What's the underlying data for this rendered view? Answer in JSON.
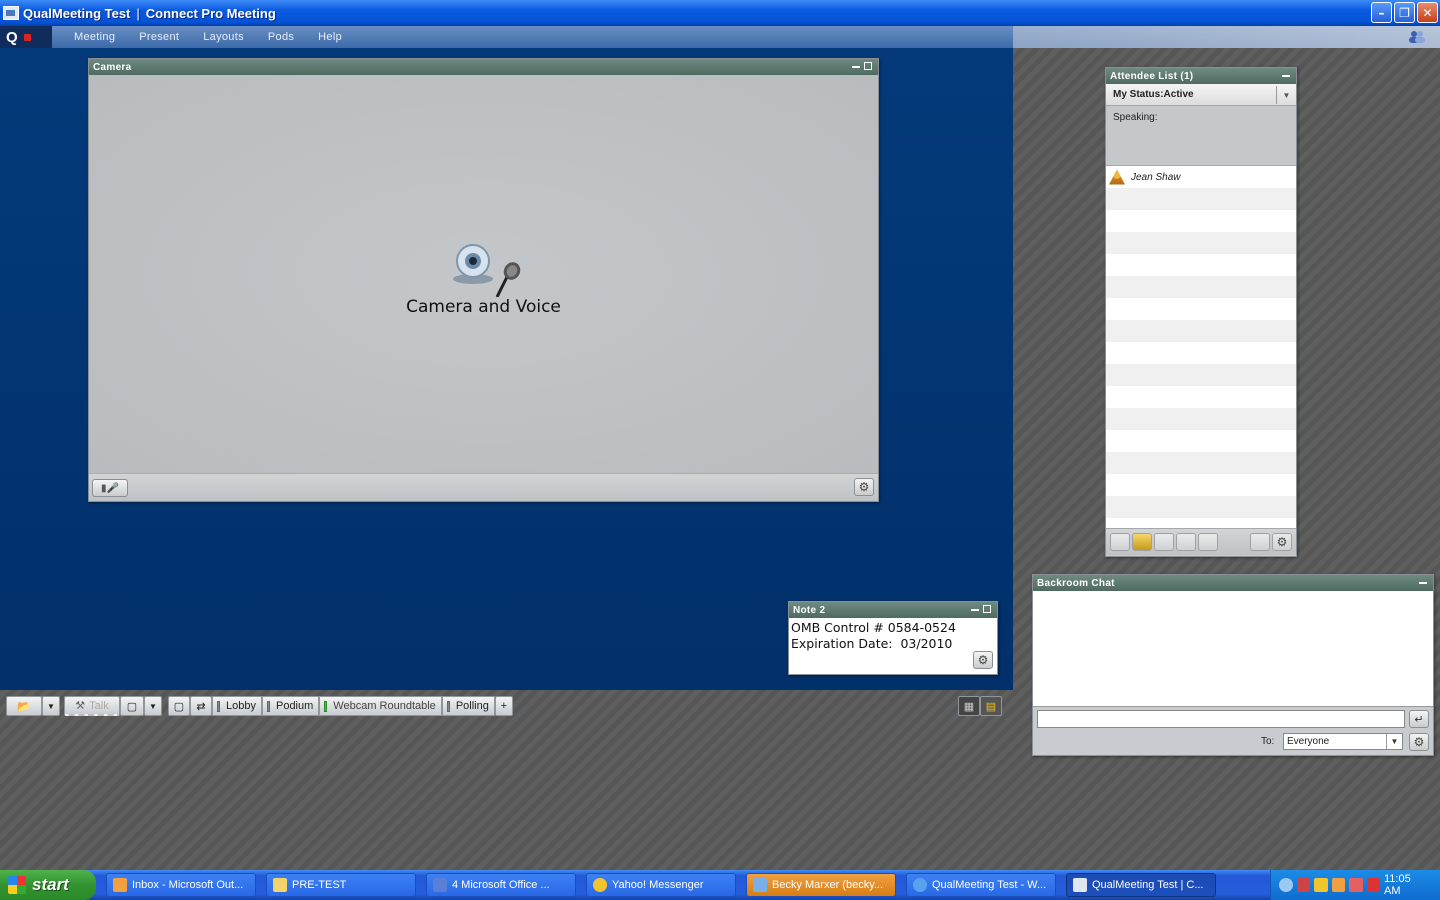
{
  "window": {
    "title": "QualMeeting Test",
    "subtitle": "Connect Pro Meeting",
    "min_icon": "minimize-icon",
    "max_icon": "restore-icon",
    "close_icon": "close-icon"
  },
  "menubar": {
    "logo": "Q",
    "items": [
      "Meeting",
      "Present",
      "Layouts",
      "Pods",
      "Help"
    ]
  },
  "camera_pod": {
    "title": "Camera",
    "placeholder_label": "Camera and Voice",
    "icon": "webcam-microphone-icon"
  },
  "attendee_pod": {
    "title": "Attendee List (1)",
    "my_status": "My Status:Active",
    "speaking_label": "Speaking:",
    "attendees": [
      {
        "name": "Jean Shaw",
        "role_icon": "host-icon"
      }
    ]
  },
  "chat_pod": {
    "title": "Backroom Chat",
    "to_label": "To:",
    "to_value": "Everyone",
    "input_placeholder": ""
  },
  "note_pod": {
    "title": "Note 2",
    "lines": [
      "OMB Control # 0584-0524",
      "Expiration Date:  03/2010"
    ]
  },
  "layout_toolbar": {
    "talk_label": "Talk",
    "tabs": [
      {
        "label": "Lobby",
        "active": false
      },
      {
        "label": "Podium",
        "active": false
      },
      {
        "label": "Webcam Roundtable",
        "active": true
      },
      {
        "label": "Polling",
        "active": false
      }
    ],
    "add_label": "+"
  },
  "taskbar": {
    "start_label": "start",
    "tasks": [
      {
        "label": "Inbox - Microsoft Out...",
        "icon": "outlook-icon",
        "color": "#f0a040"
      },
      {
        "label": "PRE-TEST",
        "icon": "folder-icon",
        "color": "#f2d36b"
      },
      {
        "label": "4 Microsoft Office ...",
        "icon": "word-icon",
        "color": "#5a7fd6"
      },
      {
        "label": "Yahoo! Messenger",
        "icon": "yahoo-messenger-icon",
        "color": "#f2c52e"
      },
      {
        "label": "Becky Marxer (becky...",
        "icon": "chat-window-icon",
        "color": "#e98a2e"
      },
      {
        "label": "QualMeeting Test - W...",
        "icon": "internet-explorer-icon",
        "color": "#59a2f0"
      },
      {
        "label": "QualMeeting Test | C...",
        "icon": "connect-pro-icon",
        "color": "#dfe6f0"
      }
    ],
    "clock": "11:05 AM"
  },
  "colors": {
    "stage": "#02306a",
    "pod_header": "#5a7a6f",
    "taskbar": "#245edb"
  }
}
